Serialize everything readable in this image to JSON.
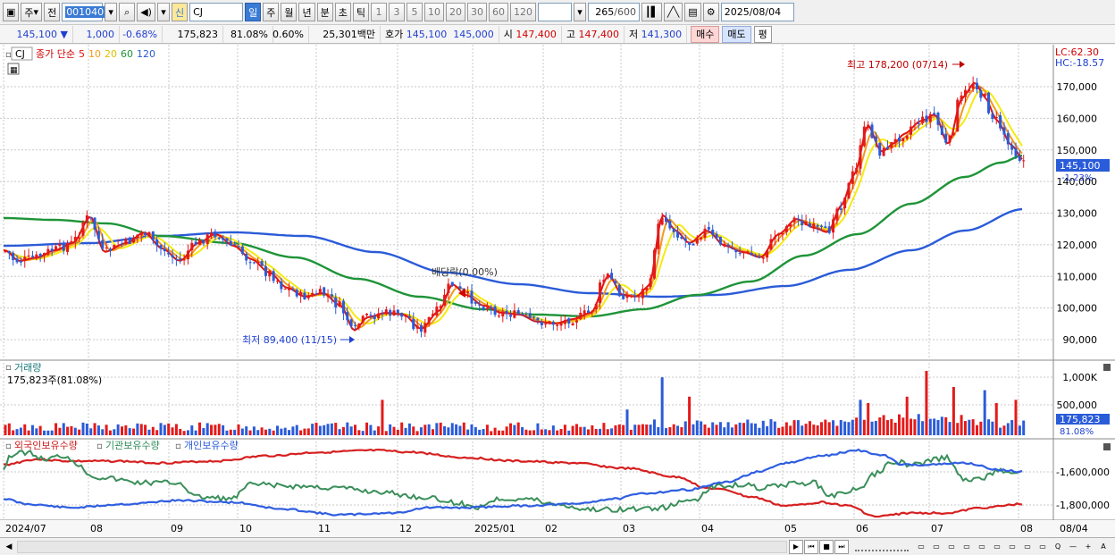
{
  "toolbar": {
    "period_btn": "주",
    "prev_btn": "전",
    "code": "001040",
    "badge_new": "신",
    "name": "CJ",
    "periods": [
      "일",
      "주",
      "월",
      "년",
      "분",
      "초",
      "틱"
    ],
    "intervals": [
      "1",
      "3",
      "5",
      "10",
      "20",
      "30",
      "60",
      "120"
    ],
    "count": "265",
    "count_max": "/600",
    "date": "2025/08/04"
  },
  "quote": {
    "price": "145,100",
    "change": "1,000",
    "rate": "-0.68%",
    "volume": "175,823",
    "vol_ratio": "81.08%",
    "turnover_rate": "0.60%",
    "amount": "25,301백만",
    "hoga_label": "호가",
    "hoga_bid": "145,100",
    "hoga_ask": "145,000",
    "open_label": "시",
    "open": "147,400",
    "high_label": "고",
    "high": "147,400",
    "low_label": "저",
    "low": "141,300",
    "buy": "매수",
    "sell": "매도",
    "avg": "평"
  },
  "price_panel": {
    "stock": "CJ",
    "legend_title": "종가 단순",
    "ma": [
      {
        "label": "5",
        "color": "#e0140e"
      },
      {
        "label": "10",
        "color": "#f39a1c"
      },
      {
        "label": "20",
        "color": "#f5ea10"
      },
      {
        "label": "60",
        "color": "#1e9438"
      },
      {
        "label": "120",
        "color": "#2a5bd8"
      }
    ],
    "lc": "LC:62.30",
    "hc": "HC:-18.57",
    "high_annot": "최고 178,200 (07/14)",
    "low_annot": "최저 89,400 (11/15)",
    "div_annot": "배당락(0.00%)",
    "cur_price": "145,100",
    "cur_rate": "-1.23%",
    "y_ticks": [
      "170,000",
      "160,000",
      "150,000",
      "140,000",
      "130,000",
      "120,000",
      "110,000",
      "100,000",
      "90,000"
    ]
  },
  "volume_panel": {
    "title": "거래량",
    "value": "175,823주(81.08%)",
    "y_ticks": [
      "1,000K",
      "500,000"
    ],
    "cur": "175,823",
    "cur_ratio": "81.08%"
  },
  "holding_panel": {
    "legend": [
      {
        "label": "외국인보유수량",
        "color": "#cc1c1c"
      },
      {
        "label": "기관보유수량",
        "color": "#2e8b57"
      },
      {
        "label": "개인보유수량",
        "color": "#2a5bd8"
      }
    ],
    "y_ticks": [
      "-1,600,000",
      "-1,800,000"
    ]
  },
  "x_axis": {
    "labels": [
      "2024/07",
      "08",
      "09",
      "10",
      "11",
      "12",
      "2025/01",
      "02",
      "03",
      "04",
      "05",
      "06",
      "07",
      "08"
    ],
    "right_label": "08/04"
  },
  "chart_data": {
    "type": "candlestick",
    "x": [
      "2024/07",
      "08",
      "09",
      "10",
      "11",
      "12",
      "2025/01",
      "02",
      "03",
      "04",
      "05",
      "06",
      "07",
      "08"
    ],
    "close_approx": [
      118000,
      125000,
      121000,
      117000,
      103000,
      96000,
      98000,
      96000,
      108000,
      124000,
      128000,
      152000,
      165000,
      145100
    ],
    "high": 178200,
    "low": 89400,
    "ylim": [
      85000,
      178000
    ]
  },
  "bottom": {
    "nav": [
      "▶",
      "⏮",
      "■",
      "⏭"
    ],
    "tools": [
      "Q",
      "—",
      "+",
      "A"
    ]
  }
}
